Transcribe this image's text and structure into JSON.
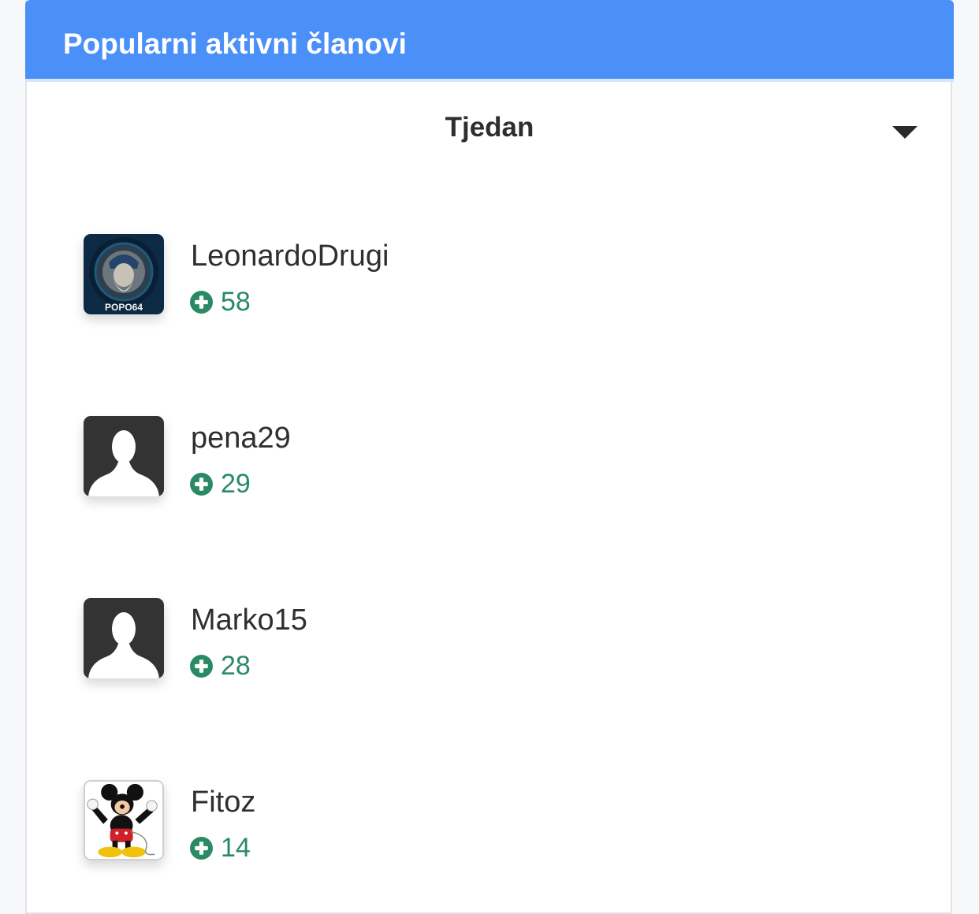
{
  "widget": {
    "title": "Popularni aktivni članovi",
    "period": {
      "selected": "Tjedan"
    },
    "members": [
      {
        "name": "LeonardoDrugi",
        "reputation": "58",
        "avatar": "leonardo-portrait",
        "avatar_caption": "POPO64"
      },
      {
        "name": "pena29",
        "reputation": "29",
        "avatar": "default-silhouette"
      },
      {
        "name": "Marko15",
        "reputation": "28",
        "avatar": "default-silhouette"
      },
      {
        "name": "Fitoz",
        "reputation": "14",
        "avatar": "mickey-mouse"
      }
    ]
  },
  "colors": {
    "header": "#4b8ff8",
    "reputation": "#2a8a66",
    "default_avatar_bg": "#333333"
  },
  "icons": {
    "reputation": "plus-circle-icon",
    "period": "caret-down-icon"
  }
}
